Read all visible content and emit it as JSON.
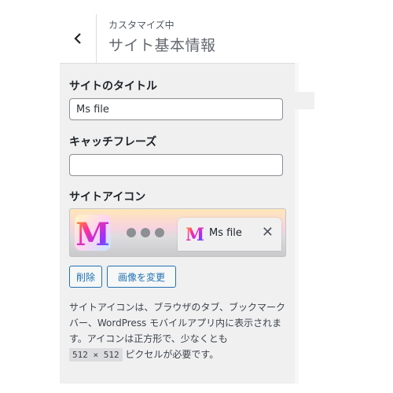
{
  "header": {
    "subtitle": "カスタマイズ中",
    "title": "サイト基本情報",
    "back_icon": "chevron-left-icon"
  },
  "fields": {
    "site_title_label": "サイトのタイトル",
    "site_title_value": "Ms file",
    "tagline_label": "キャッチフレーズ",
    "tagline_value": ""
  },
  "site_icon": {
    "label": "サイトアイコン",
    "preview_tab_title": "Ms file",
    "icon_letter": "M",
    "close_symbol": "✕",
    "remove_button": "削除",
    "change_button": "画像を変更"
  },
  "description": {
    "text_1": "サイトアイコンは、ブラウザのタブ、ブックマークバー、WordPress モバイルアプリ内に表示されます。アイコンは正方形で、少なくとも",
    "size_code": "512 × 512",
    "text_2": " ピクセルが必要です。"
  },
  "colors": {
    "accent": "#2271b1",
    "panel_bg": "#f0f0f1"
  }
}
